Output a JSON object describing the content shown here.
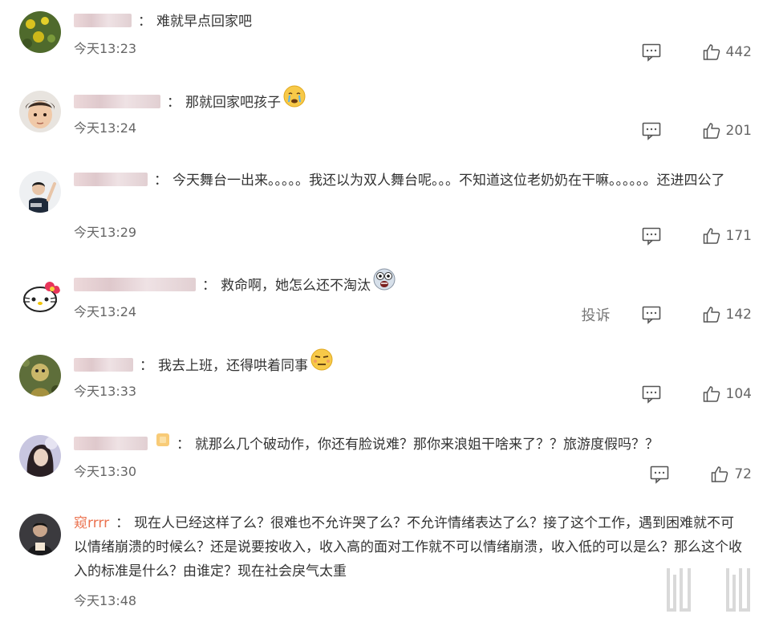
{
  "comments": [
    {
      "text": "难就早点回家吧",
      "time": "今天13:23",
      "likes": "442",
      "report": ""
    },
    {
      "text": "那就回家吧孩子",
      "time": "今天13:24",
      "likes": "201",
      "report": ""
    },
    {
      "text": "今天舞台一出来。。。。。我还以为双人舞台呢。。。不知道这位老奶奶在干嘛。。。。。。还进四公了",
      "time": "今天13:29",
      "likes": "171",
      "report": ""
    },
    {
      "text": "救命啊，她怎么还不淘汰",
      "time": "今天13:24",
      "likes": "142",
      "report": "投诉"
    },
    {
      "text": "我去上班，还得哄着同事",
      "time": "今天13:33",
      "likes": "104",
      "report": ""
    },
    {
      "text": "就那么几个破动作，你还有脸说难？那你来浪姐干啥来了？？旅游度假吗？？",
      "time": "今天13:30",
      "likes": "72",
      "report": ""
    },
    {
      "user": "窥rrrr",
      "text": "现在人已经这样了么？很难也不允许哭了么？不允许情绪表达了么？接了这个工作，遇到困难就不可以情绪崩溃的时候么？还是说要按收入，收入高的面对工作就不可以情绪崩溃，收入低的可以是么？那么这个收入的标准是什么？由谁定？现在社会戾气太重",
      "time": "今天13:48"
    }
  ],
  "separator": "：",
  "icons": {
    "reply": "comment-icon",
    "like": "thumbs-up-icon"
  },
  "colors": {
    "username": "#eb7350",
    "text": "#333333",
    "meta": "#666666"
  }
}
